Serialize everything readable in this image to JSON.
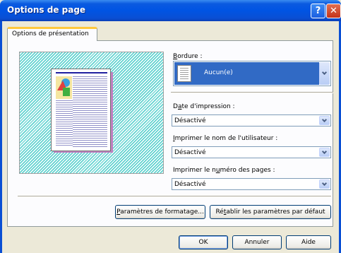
{
  "window": {
    "title": "Options de page",
    "help_icon": "question-mark-icon",
    "close_icon": "close-icon"
  },
  "tabs": [
    {
      "label": "Options de présentation",
      "active": true
    }
  ],
  "fields": {
    "bordure": {
      "label_u": "B",
      "label_rest": "ordure :",
      "value": "Aucun(e)"
    },
    "date": {
      "label_pre": "D",
      "label_u": "a",
      "label_rest": "te d'impression :",
      "value": "Désactivé"
    },
    "user": {
      "label_u": "I",
      "label_rest": "mprimer le nom de l'utilisateur :",
      "value": "Désactivé"
    },
    "pages": {
      "label_pre": "Imprimer le n",
      "label_u": "u",
      "label_rest": "méro des pages :",
      "value": "Désactivé"
    }
  },
  "buttons": {
    "format_pre": "",
    "format_u": "P",
    "format_rest": "aramètres de formatage...",
    "reset_pre": "Ré",
    "reset_u": "t",
    "reset_rest": "ablir les paramètres par défaut",
    "ok": "OK",
    "cancel": "Annuler",
    "help": "Aide"
  },
  "colors": {
    "titlebar": "#0054e3",
    "selection": "#316ac5",
    "tab_highlight": "#ffc83c",
    "preview_hatch": "#2ec4c0",
    "page_header": "#2020a0"
  }
}
